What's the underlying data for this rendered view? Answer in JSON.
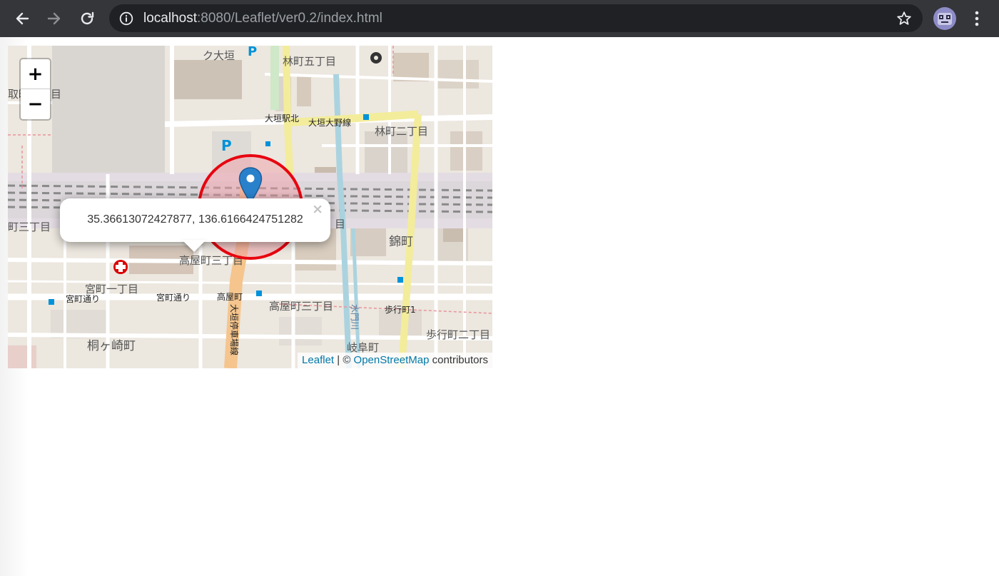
{
  "browser": {
    "url_host": "localhost",
    "url_path": ":8080/Leaflet/ver0.2/index.html",
    "icons": [
      "back-arrow-icon",
      "forward-arrow-icon",
      "reload-icon",
      "info-icon",
      "star-icon",
      "profile-avatar-icon",
      "more-vert-icon"
    ]
  },
  "map": {
    "zoom_in_label": "+",
    "zoom_out_label": "−",
    "popup_text": "35.36613072427877, 136.6166424751282",
    "popup_close": "×",
    "attribution_leaflet": "Leaflet",
    "attribution_sep": " | © ",
    "attribution_osm": "OpenStreetMap",
    "attribution_suffix": " contributors",
    "labels": {
      "ku_ogaki": "ク大垣",
      "hayashi5": "林町五丁目",
      "ogaki_station_north": "大垣駅北",
      "ogaki_ono_line": "大垣大野線",
      "hayashi2": "林町二丁目",
      "mame": "目",
      "toshiro": "取町",
      "three_chome": "町三丁目",
      "nishiki": "錦町",
      "takaya3_top": "高屋町三丁目",
      "miyamachi1": "宮町一丁目",
      "miyamachi_dori1": "宮町通り",
      "miyamachi_dori2": "宮町通り",
      "takayamachi": "高屋町",
      "takaya3": "高屋町三丁目",
      "hokomachi1": "歩行町1",
      "hokomachi2": "歩行町二丁目",
      "kirigasaki": "桐ヶ崎町",
      "gifumachi": "岐阜町",
      "suimon_river": "水門川",
      "ekimae_line": "大垣停車場線",
      "parking": "P"
    },
    "colors": {
      "circle_stroke": "#e8040f",
      "circle_fill": "#f0a0a8",
      "marker": "#2a81cb",
      "link": "#0078a8"
    }
  }
}
